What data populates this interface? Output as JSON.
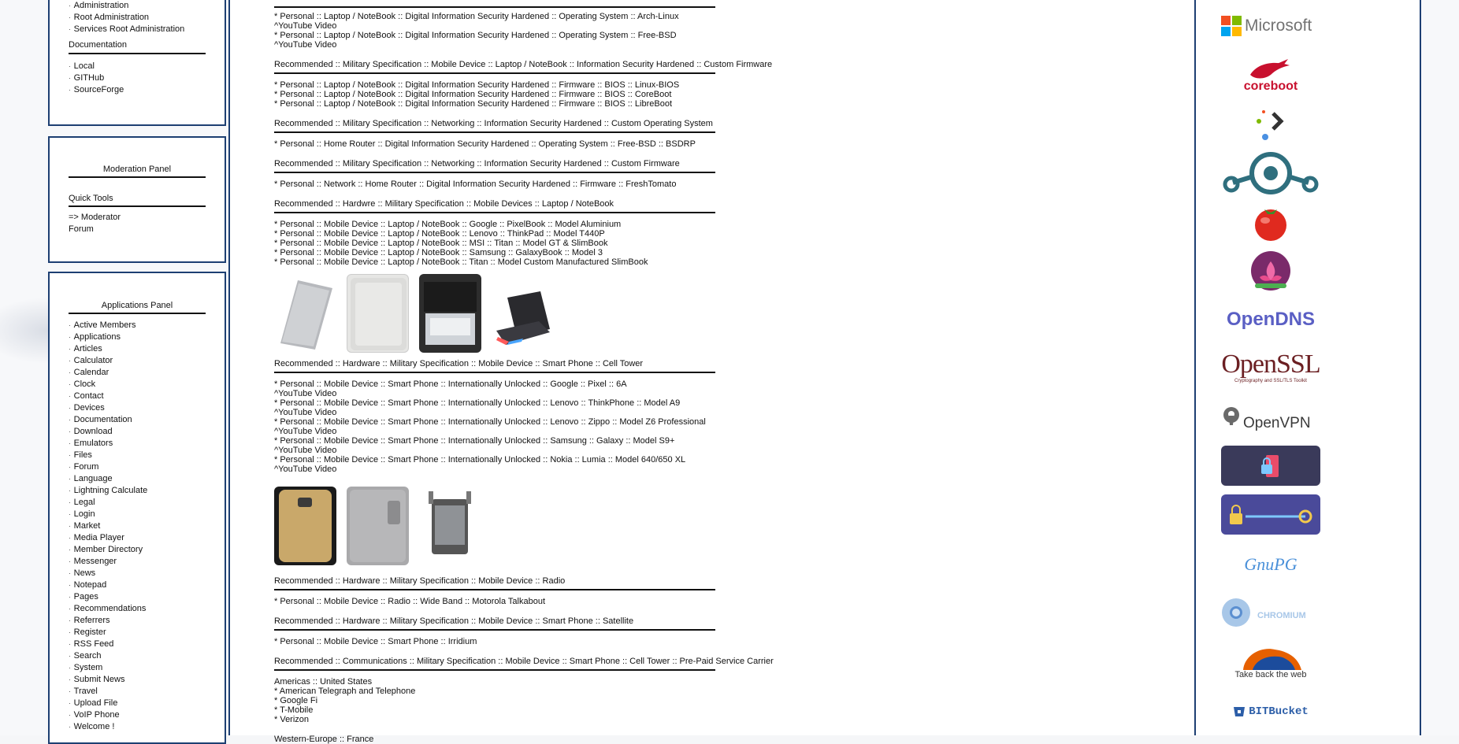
{
  "left_sidebar": {
    "top_panel": {
      "admin_items": [
        "Administration",
        "Root Administration",
        "Services Root Administration"
      ],
      "documentation_heading": "Documentation",
      "documentation_items": [
        "Local",
        "GITHub",
        "SourceForge"
      ]
    },
    "moderation_panel": {
      "title": "Moderation Panel",
      "quick_tools_heading": "Quick Tools",
      "items": [
        "=> Moderator",
        "Forum"
      ]
    },
    "applications_panel": {
      "title": "Applications Panel",
      "items": [
        "Active Members",
        "Applications",
        "Articles",
        "Calculator",
        "Calendar",
        "Clock",
        "Contact",
        "Devices",
        "Documentation",
        "Download",
        "Emulators",
        "Files",
        "Forum",
        "Language",
        "Lightning Calculate",
        "Legal",
        "Login",
        "Market",
        "Media Player",
        "Member Directory",
        "Messenger",
        "News",
        "Notepad",
        "Pages",
        "Recommendations",
        "Referrers",
        "Register",
        "RSS Feed",
        "Search",
        "System",
        "Submit News",
        "Travel",
        "Upload File",
        "VoIP Phone",
        "Welcome !"
      ]
    }
  },
  "content": {
    "block1": [
      "* Personal :: Laptop / NoteBook :: Digital Information Security Hardened :: Operating System :: Arch-Linux",
      "^YouTube Video",
      "* Personal :: Laptop / NoteBook :: Digital Information Security Hardened :: Operating System :: Free-BSD",
      "^YouTube Video"
    ],
    "heading2": "Recommended :: Military Specification :: Mobile Device :: Laptop / NoteBook :: Information Security Hardened :: Custom Firmware",
    "block2": [
      "* Personal :: Laptop / NoteBook :: Digital Information Security Hardened :: Firmware :: BIOS :: Linux-BIOS",
      "* Personal :: Laptop / NoteBook :: Digital Information Security Hardened :: Firmware :: BIOS :: CoreBoot",
      "* Personal :: Laptop / NoteBook :: Digital Information Security Hardened :: Firmware :: BIOS :: LibreBoot"
    ],
    "heading3": "Recommended :: Military Specification :: Networking :: Information Security Hardened :: Custom Operating System",
    "block3": [
      "* Personal :: Home Router :: Digital Information Security Hardened :: Operating System :: Free-BSD :: BSDRP"
    ],
    "heading4": "Recommended :: Military Specification :: Networking :: Information Security Hardened :: Custom Firmware",
    "block4": [
      "* Personal :: Network :: Home Router :: Digital Information Security Hardened :: Firmware :: FreshTomato"
    ],
    "heading5": "Recommended :: Hardwre :: Military Specification :: Mobile Devices :: Laptop / NoteBook",
    "block5": [
      "* Personal :: Mobile Device :: Laptop / NoteBook :: Google :: PixelBook :: Model Aluminium",
      "* Personal :: Mobile Device :: Laptop / NoteBook :: Lenovo :: ThinkPad :: Model T440P",
      "* Personal :: Mobile Device :: Laptop / NoteBook :: MSI :: Titan :: Model GT & SlimBook",
      "* Personal :: Mobile Device :: Laptop / NoteBook :: Samsung :: GalaxyBook :: Model 3",
      "* Personal :: Mobile Device :: Laptop / NoteBook :: Titan :: Model Custom Manufactured SlimBook"
    ],
    "heading6": "Recommended :: Hardware :: Military Specification :: Mobile Device :: Smart Phone :: Cell Tower",
    "block6": [
      "* Personal :: Mobile Device :: Smart Phone :: Internationally Unlocked :: Google :: Pixel :: 6A",
      "^YouTube Video",
      "* Personal :: Mobile Device :: Smart Phone :: Internationally Unlocked :: Lenovo :: ThinkPhone :: Model A9",
      "^YouTube Video",
      "* Personal :: Mobile Device :: Smart Phone :: Internationally Unlocked :: Lenovo :: Zippo :: Model Z6 Professional",
      "^YouTube Video",
      "* Personal :: Mobile Device :: Smart Phone :: Internationally Unlocked :: Samsung :: Galaxy :: Model S9+",
      "^YouTube Video",
      "* Personal :: Mobile Device :: Smart Phone :: Internationally Unlocked :: Nokia :: Lumia :: Model 640/650 XL",
      "^YouTube Video"
    ],
    "heading7": "Recommended :: Hardware :: Military Specification :: Mobile Device :: Radio",
    "block7": [
      "* Personal :: Mobile Device :: Radio :: Wide Band :: Motorola Talkabout"
    ],
    "heading8": "Recommended :: Hardware :: Military Specification :: Mobile Device :: Smart Phone :: Satellite",
    "block8": [
      "* Personal :: Mobile Device :: Smart Phone :: Irridium"
    ],
    "heading9": "Recommended :: Communications :: Military Specification :: Mobile Device :: Smart Phone :: Cell Tower :: Pre-Paid Service Carrier",
    "block9": [
      "Americas :: United States",
      "* American Telegraph and Telephone",
      "* Google Fi",
      "* T-Mobile",
      "* Verizon"
    ],
    "block10": [
      "Western-Europe :: France"
    ]
  },
  "right_sidebar": {
    "logos": {
      "microsoft": "Microsoft",
      "coreboot": "coreboot",
      "opendns": "OpenDNS",
      "openssl": "OpenSSL",
      "openssl_tagline": "Cryptography and SSL/TLS Toolkit",
      "openvpn": "OpenVPN",
      "gnupg": "GnuPG",
      "chromium": "CHROMIUM",
      "firefox_tagline": "Take back the web",
      "bitbucket": "BITBucket"
    }
  },
  "colors": {
    "panel_border": "#1d3f72",
    "microsoft_red": "#f25022",
    "microsoft_green": "#7fba00",
    "microsoft_blue": "#00a4ef",
    "microsoft_yellow": "#ffb900",
    "coreboot_red": "#c8102e",
    "lineage_teal": "#2f6f7e",
    "opendns_purple": "#5a5fc4",
    "openssl_maroon": "#6b1f22",
    "bitbucket_blue": "#2c5ea8"
  }
}
